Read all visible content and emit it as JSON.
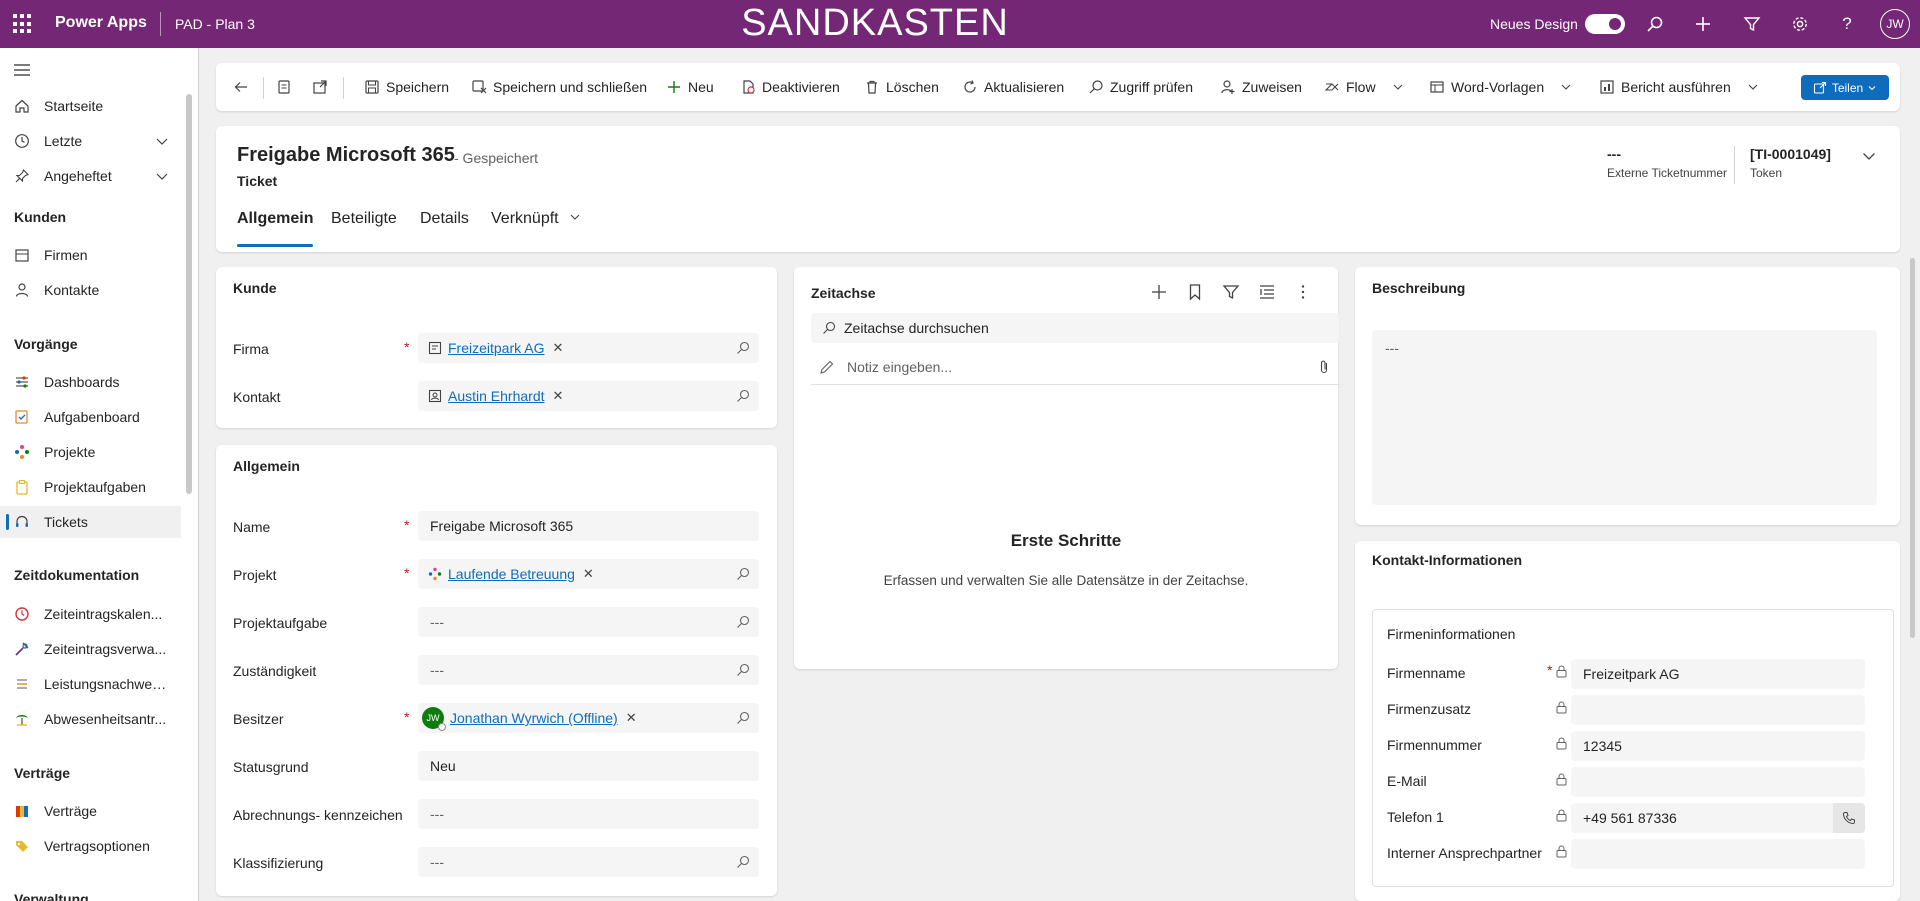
{
  "topbar": {
    "app_name": "Power Apps",
    "environment": "PAD - Plan 3",
    "sandbox_label": "SANDKASTEN",
    "new_design_label": "Neues Design",
    "avatar_initials": "JW"
  },
  "nav": {
    "items": [
      {
        "label": "Startseite",
        "icon": "home-icon"
      },
      {
        "label": "Letzte",
        "icon": "clock-icon"
      },
      {
        "label": "Angeheftet",
        "icon": "pin-icon"
      }
    ],
    "groups": [
      {
        "title": "Kunden",
        "items": [
          {
            "label": "Firmen"
          },
          {
            "label": "Kontakte"
          }
        ]
      },
      {
        "title": "Vorgänge",
        "items": [
          {
            "label": "Dashboards"
          },
          {
            "label": "Aufgabenboard"
          },
          {
            "label": "Projekte"
          },
          {
            "label": "Projektaufgaben"
          },
          {
            "label": "Tickets"
          }
        ]
      },
      {
        "title": "Zeitdokumentation",
        "items": [
          {
            "label": "Zeiteintragskalen..."
          },
          {
            "label": "Zeiteintragsverwa..."
          },
          {
            "label": "Leistungsnachweise"
          },
          {
            "label": "Abwesenheitsantr..."
          }
        ]
      },
      {
        "title": "Verträge",
        "items": [
          {
            "label": "Verträge"
          },
          {
            "label": "Vertragsoptionen"
          }
        ]
      },
      {
        "title": "Verwaltung"
      }
    ]
  },
  "commands": {
    "save": "Speichern",
    "save_close": "Speichern und schließen",
    "new": "Neu",
    "deactivate": "Deaktivieren",
    "delete": "Löschen",
    "refresh": "Aktualisieren",
    "check_access": "Zugriff prüfen",
    "assign": "Zuweisen",
    "flow": "Flow",
    "word_templates": "Word-Vorlagen",
    "run_report": "Bericht ausführen",
    "share": "Teilen"
  },
  "record": {
    "title": "Freigabe Microsoft 365",
    "saved_status": "- Gespeichert",
    "entity": "Ticket",
    "header_fields": [
      {
        "value": "---",
        "label": "Externe Ticketnummer"
      },
      {
        "value": "[TI-0001049]",
        "label": "Token"
      }
    ],
    "tabs": [
      "Allgemein",
      "Beteiligte",
      "Details",
      "Verknüpft"
    ]
  },
  "kunde": {
    "title": "Kunde",
    "firma_label": "Firma",
    "firma_value": "Freizeitpark AG",
    "kontakt_label": "Kontakt",
    "kontakt_value": "Austin Ehrhardt"
  },
  "allgemein": {
    "title": "Allgemein",
    "fields": {
      "name_label": "Name",
      "name_value": "Freigabe Microsoft 365",
      "projekt_label": "Projekt",
      "projekt_value": "Laufende Betreuung",
      "projektaufgabe_label": "Projektaufgabe",
      "projektaufgabe_value": "---",
      "zustaendigkeit_label": "Zuständigkeit",
      "zustaendigkeit_value": "---",
      "besitzer_label": "Besitzer",
      "besitzer_value": "Jonathan Wyrwich (Offline)",
      "besitzer_initials": "JW",
      "statusgrund_label": "Statusgrund",
      "statusgrund_value": "Neu",
      "abrechnung_label": "Abrechnungs- kennzeichen",
      "abrechnung_value": "---",
      "klassifizierung_label": "Klassifizierung",
      "klassifizierung_value": "---"
    }
  },
  "timeline": {
    "title": "Zeitachse",
    "search_placeholder": "Zeitachse durchsuchen",
    "note_placeholder": "Notiz eingeben...",
    "empty_title": "Erste Schritte",
    "empty_subtitle": "Erfassen und verwalten Sie alle Datensätze in der Zeitachse."
  },
  "beschreibung": {
    "title": "Beschreibung",
    "value": "---"
  },
  "kontakt_info": {
    "title": "Kontakt-Informationen",
    "section": "Firmeninformationen",
    "rows": [
      {
        "label": "Firmenname",
        "value": "Freizeitpark AG",
        "required": true
      },
      {
        "label": "Firmenzusatz",
        "value": ""
      },
      {
        "label": "Firmennummer",
        "value": "12345"
      },
      {
        "label": "E-Mail",
        "value": ""
      },
      {
        "label": "Telefon 1",
        "value": "+49 561 87336"
      },
      {
        "label": "Interner Ansprechpartner",
        "value": ""
      }
    ]
  },
  "colors": {
    "topbar": "#742774",
    "accent": "#0f6cbd",
    "required": "#c50f1f"
  }
}
